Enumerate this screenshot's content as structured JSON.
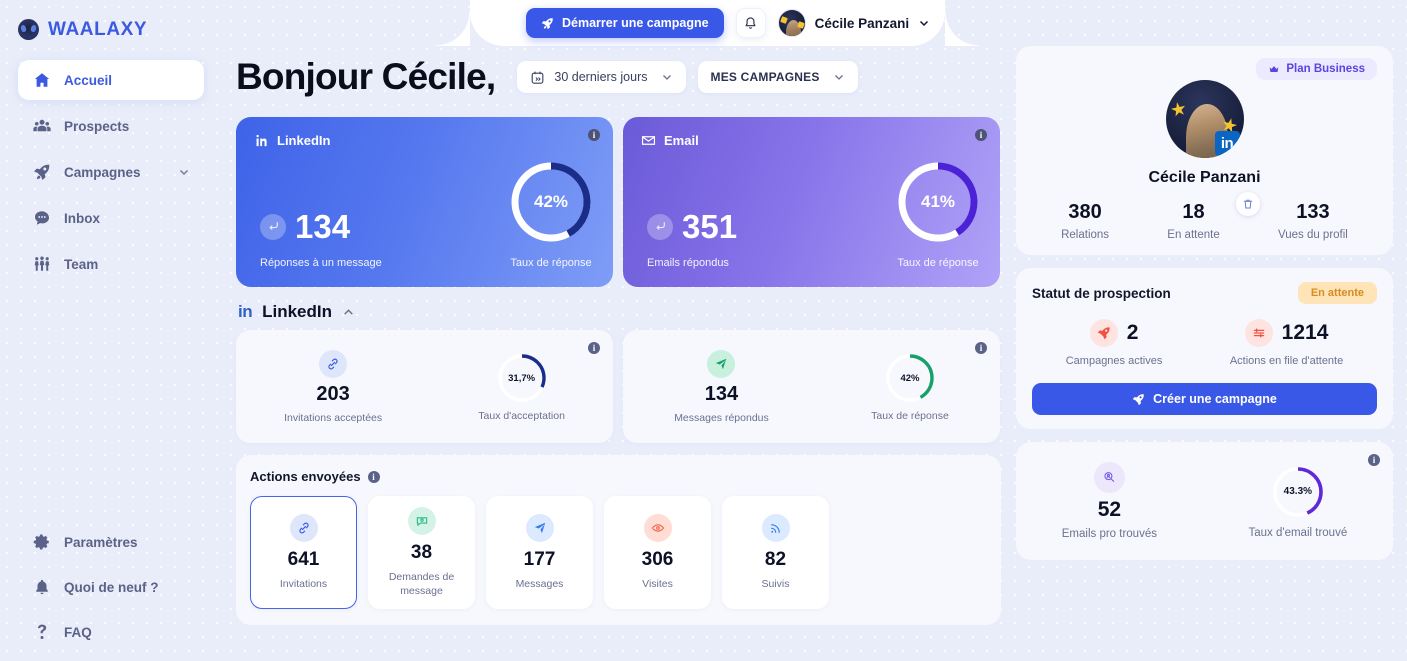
{
  "brand": {
    "name": "WAALAXY"
  },
  "sidebar": {
    "items": [
      {
        "label": "Accueil",
        "icon": "home-icon",
        "active": true
      },
      {
        "label": "Prospects",
        "icon": "people-icon",
        "active": false
      },
      {
        "label": "Campagnes",
        "icon": "rocket-icon",
        "active": false,
        "chevron": true
      },
      {
        "label": "Inbox",
        "icon": "chat-icon",
        "active": false
      },
      {
        "label": "Team",
        "icon": "team-icon",
        "active": false
      }
    ],
    "bottom_items": [
      {
        "label": "Paramètres",
        "icon": "gear-icon"
      },
      {
        "label": "Quoi de neuf ?",
        "icon": "bell-icon"
      },
      {
        "label": "FAQ",
        "icon": "question-icon"
      }
    ]
  },
  "header": {
    "campaign_button": "Démarrer une campagne",
    "user_name": "Cécile Panzani"
  },
  "main": {
    "greeting": "Bonjour Cécile,",
    "date_filter": "30 derniers jours",
    "campaign_filter": "MES CAMPAGNES",
    "big_cards": [
      {
        "platform": "LinkedIn",
        "icon": "linkedin-icon",
        "value": "134",
        "caption": "Réponses à un message",
        "rate": "42%",
        "rate_caption": "Taux de réponse",
        "rate_pct": 42,
        "arc_color": "#1b2d8a"
      },
      {
        "platform": "Email",
        "icon": "envelope-icon",
        "value": "351",
        "caption": "Emails répondus",
        "rate": "41%",
        "rate_caption": "Taux de réponse",
        "rate_pct": 41,
        "arc_color": "#4b22d6"
      }
    ],
    "section": {
      "logo": "in",
      "title": "LinkedIn"
    },
    "white_cards": [
      {
        "value": "203",
        "caption": "Invitations acceptées",
        "icon": "link-icon",
        "icon_bg": "#dde6fb",
        "icon_color": "#3a58e8",
        "rate": "31,7%",
        "rate_caption": "Taux d'acceptation",
        "rate_pct": 31.7,
        "arc_color": "#1b2d8a"
      },
      {
        "value": "134",
        "caption": "Messages répondus",
        "icon": "send-icon",
        "icon_bg": "#c7f0dd",
        "icon_color": "#17a06a",
        "rate": "42%",
        "rate_caption": "Taux de réponse",
        "rate_pct": 42,
        "arc_color": "#17a06a"
      }
    ],
    "actions_panel": {
      "title": "Actions envoyées",
      "cards": [
        {
          "value": "641",
          "label": "Invitations",
          "icon": "link-icon",
          "icon_bg": "#dde6fb",
          "icon_color": "#3a58e8",
          "selected": true
        },
        {
          "value": "38",
          "label": "Demandes de message",
          "icon": "message-request-icon",
          "icon_bg": "#d4f3e6",
          "icon_color": "#2bb98a",
          "selected": false
        },
        {
          "value": "177",
          "label": "Messages",
          "icon": "send-icon",
          "icon_bg": "#dbeafe",
          "icon_color": "#3a7de8",
          "selected": false
        },
        {
          "value": "306",
          "label": "Visites",
          "icon": "eye-icon",
          "icon_bg": "#ffdcd4",
          "icon_color": "#f0694a",
          "selected": false
        },
        {
          "value": "82",
          "label": "Suivis",
          "icon": "rss-icon",
          "icon_bg": "#dbeafe",
          "icon_color": "#3a7de8",
          "selected": false
        }
      ]
    }
  },
  "right": {
    "profile": {
      "plan_badge": "Plan Business",
      "name": "Cécile Panzani",
      "stats": [
        {
          "value": "380",
          "label": "Relations"
        },
        {
          "value": "18",
          "label": "En attente"
        },
        {
          "value": "133",
          "label": "Vues du profil"
        }
      ]
    },
    "prospection": {
      "title": "Statut de prospection",
      "badge": "En attente",
      "stats": [
        {
          "value": "2",
          "label": "Campagnes actives",
          "icon": "rocket-icon"
        },
        {
          "value": "1214",
          "label": "Actions en file d'attente",
          "icon": "queue-icon"
        }
      ],
      "button": "Créer une campagne"
    },
    "email_found": {
      "value": "52",
      "caption": "Emails pro trouvés",
      "icon": "email-search-icon",
      "rate": "43.3%",
      "rate_caption": "Taux d'email trouvé",
      "rate_pct": 43.3,
      "arc_color": "#6028d9"
    }
  },
  "colors": {
    "accent": "#3a58e8",
    "background": "#e9edfa",
    "card": "#f7f8fd"
  }
}
